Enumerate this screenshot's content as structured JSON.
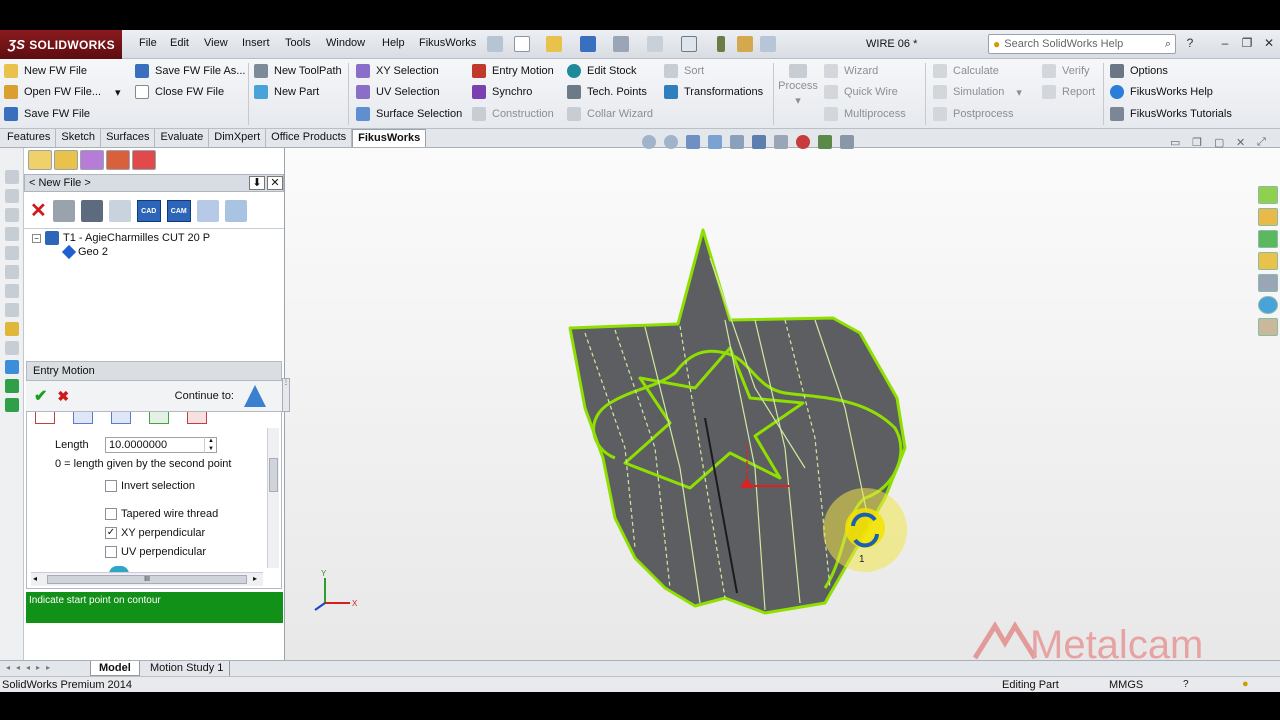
{
  "app": {
    "name": "SOLIDWORKS",
    "doc_title": "WIRE 06 *"
  },
  "menu": [
    "File",
    "Edit",
    "View",
    "Insert",
    "Tools",
    "Window",
    "Help",
    "FikusWorks"
  ],
  "search": {
    "placeholder": "Search SolidWorks Help"
  },
  "ribbon": {
    "col1": [
      "New FW File",
      "Open FW File...",
      "Save FW File"
    ],
    "col2": [
      "Save FW File As...",
      "Close FW File"
    ],
    "col3": [
      "New ToolPath",
      "New Part"
    ],
    "col4": [
      "XY Selection",
      "UV Selection",
      "Surface Selection"
    ],
    "col5": [
      "Entry Motion",
      "Synchro",
      "Construction"
    ],
    "col6": [
      "Edit Stock",
      "Tech. Points",
      "Collar Wizard"
    ],
    "col7": [
      "Sort",
      "Transformations"
    ],
    "process": "Process",
    "col8": [
      "Wizard",
      "Quick Wire",
      "Multiprocess"
    ],
    "col9": [
      "Calculate",
      "Simulation",
      "Postprocess"
    ],
    "col10": [
      "Verify",
      "Report"
    ],
    "col11": [
      "Options",
      "FikusWorks Help",
      "FikusWorks Tutorials"
    ]
  },
  "tabs": [
    "Features",
    "Sketch",
    "Surfaces",
    "Evaluate",
    "DimXpert",
    "Office Products",
    "FikusWorks"
  ],
  "active_tab": "FikusWorks",
  "fm": {
    "header": "< New File >",
    "cad": "CAD",
    "cam": "CAM",
    "tree": {
      "tool": "T1 - AgieCharmilles CUT 20 P",
      "geo": "Geo 2"
    }
  },
  "entry_motion": {
    "title": "Entry Motion",
    "continue_label": "Continue to:",
    "length_label": "Length",
    "length_value": "10.0000000",
    "hint": "0 = length given by the second point",
    "options": [
      {
        "label": "Invert selection",
        "checked": false
      },
      {
        "label": "Tapered wire thread",
        "checked": false
      },
      {
        "label": "XY perpendicular",
        "checked": true
      },
      {
        "label": "UV perpendicular",
        "checked": false
      }
    ],
    "scroll_mark": "III"
  },
  "prompt": "Indicate start point on contour",
  "bottom_tabs": [
    "Model",
    "Motion Study 1"
  ],
  "status": {
    "left": "SolidWorks Premium 2014",
    "editing": "Editing Part",
    "units": "MMGS"
  },
  "watermark": "Metalcam",
  "triad": {
    "x": "X",
    "y": "Y"
  },
  "point_label": "1",
  "colors": {
    "accent_green": "#129118",
    "contour": "#8fe000",
    "logo_red": "#8a1a1e"
  }
}
